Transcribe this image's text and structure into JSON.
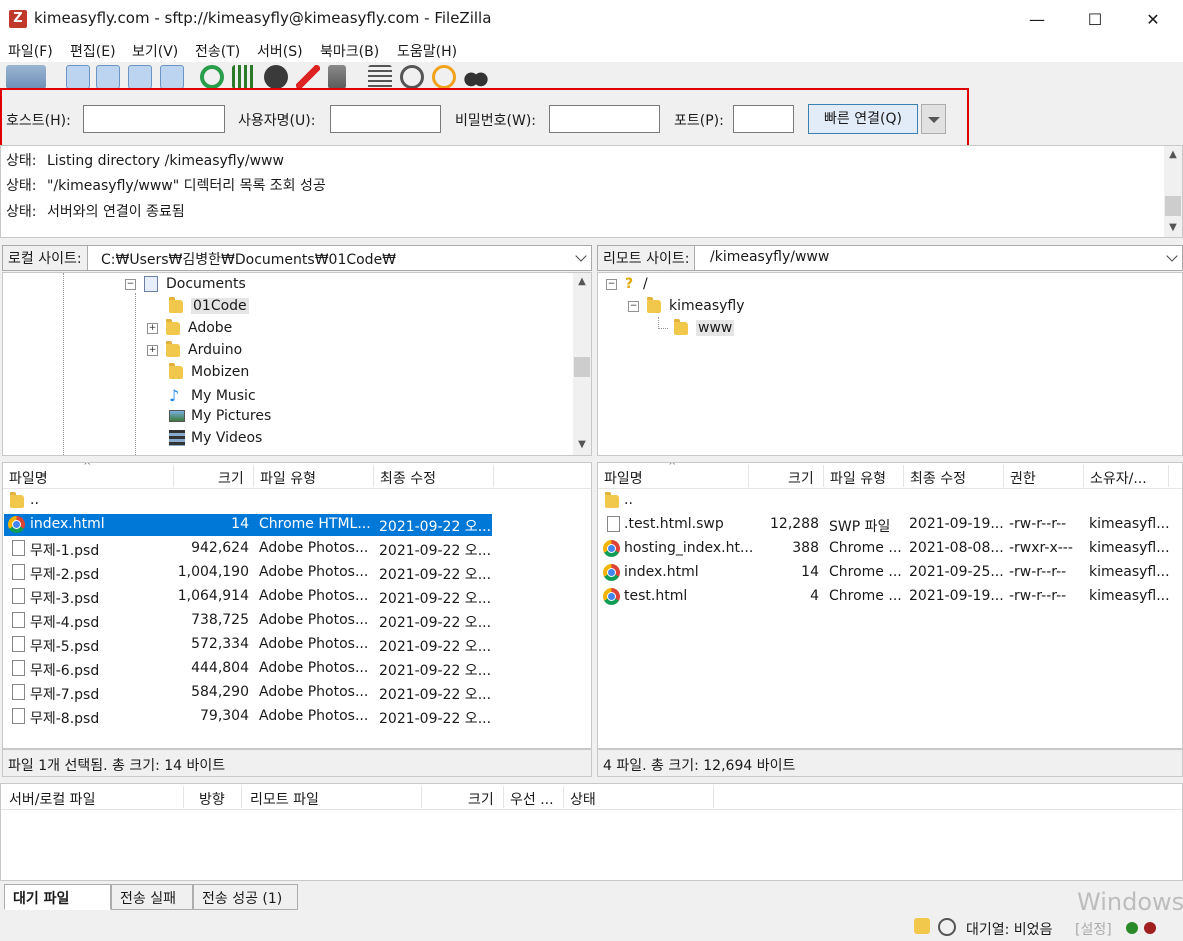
{
  "window": {
    "title": "kimeasyfly.com - sftp://kimeasyfly@kimeasyfly.com - FileZilla",
    "app_icon": "Z",
    "minimize": "—",
    "maximize": "☐",
    "close": "✕"
  },
  "menu": [
    "파일(F)",
    "편집(E)",
    "보기(V)",
    "전송(T)",
    "서버(S)",
    "북마크(B)",
    "도움말(H)"
  ],
  "quickconnect": {
    "host_label": "호스트(H):",
    "host_value": "",
    "user_label": "사용자명(U):",
    "user_value": "",
    "pass_label": "비밀번호(W):",
    "pass_value": "",
    "port_label": "포트(P):",
    "port_value": "",
    "button": "빠른 연결(Q)"
  },
  "messages": [
    {
      "kind": "상태:",
      "text": "Listing directory /kimeasyfly/www"
    },
    {
      "kind": "상태:",
      "text": "\"/kimeasyfly/www\" 디렉터리 목록 조회 성공"
    },
    {
      "kind": "상태:",
      "text": "서버와의 연결이 종료됨"
    }
  ],
  "local": {
    "site_label": "로컬 사이트:",
    "path": "C:₩Users₩김병한₩Documents₩01Code₩",
    "tree": [
      "Documents",
      "01Code",
      "Adobe",
      "Arduino",
      "Mobizen",
      "My Music",
      "My Pictures",
      "My Videos"
    ],
    "columns": [
      "파일명",
      "크기",
      "파일 유형",
      "최종 수정"
    ],
    "files": [
      {
        "name": "..",
        "size": "",
        "type": "",
        "modified": ""
      },
      {
        "name": "index.html",
        "size": "14",
        "type": "Chrome HTML...",
        "modified": "2021-09-22 오..."
      },
      {
        "name": "무제-1.psd",
        "size": "942,624",
        "type": "Adobe Photos...",
        "modified": "2021-09-22 오..."
      },
      {
        "name": "무제-2.psd",
        "size": "1,004,190",
        "type": "Adobe Photos...",
        "modified": "2021-09-22 오..."
      },
      {
        "name": "무제-3.psd",
        "size": "1,064,914",
        "type": "Adobe Photos...",
        "modified": "2021-09-22 오..."
      },
      {
        "name": "무제-4.psd",
        "size": "738,725",
        "type": "Adobe Photos...",
        "modified": "2021-09-22 오..."
      },
      {
        "name": "무제-5.psd",
        "size": "572,334",
        "type": "Adobe Photos...",
        "modified": "2021-09-22 오..."
      },
      {
        "name": "무제-6.psd",
        "size": "444,804",
        "type": "Adobe Photos...",
        "modified": "2021-09-22 오..."
      },
      {
        "name": "무제-7.psd",
        "size": "584,290",
        "type": "Adobe Photos...",
        "modified": "2021-09-22 오..."
      },
      {
        "name": "무제-8.psd",
        "size": "79,304",
        "type": "Adobe Photos...",
        "modified": "2021-09-22 오..."
      }
    ],
    "status": "파일 1개 선택됨. 총 크기: 14 바이트"
  },
  "remote": {
    "site_label": "리모트 사이트:",
    "path": "/kimeasyfly/www",
    "tree": [
      "/",
      "kimeasyfly",
      "www"
    ],
    "columns": [
      "파일명",
      "크기",
      "파일 유형",
      "최종 수정",
      "권한",
      "소유자/..."
    ],
    "files": [
      {
        "name": "..",
        "size": "",
        "type": "",
        "modified": "",
        "perm": "",
        "owner": ""
      },
      {
        "name": ".test.html.swp",
        "size": "12,288",
        "type": "SWP 파일",
        "modified": "2021-09-19...",
        "perm": "-rw-r--r--",
        "owner": "kimeasyfl..."
      },
      {
        "name": "hosting_index.ht...",
        "size": "388",
        "type": "Chrome ...",
        "modified": "2021-08-08...",
        "perm": "-rwxr-x---",
        "owner": "kimeasyfl..."
      },
      {
        "name": "index.html",
        "size": "14",
        "type": "Chrome ...",
        "modified": "2021-09-25...",
        "perm": "-rw-r--r--",
        "owner": "kimeasyfl..."
      },
      {
        "name": "test.html",
        "size": "4",
        "type": "Chrome ...",
        "modified": "2021-09-19...",
        "perm": "-rw-r--r--",
        "owner": "kimeasyfl..."
      }
    ],
    "status": "4 파일. 총 크기: 12,694 바이트"
  },
  "queue": {
    "columns": [
      "서버/로컬 파일",
      "방향",
      "리모트 파일",
      "크기",
      "우선 ...",
      "상태"
    ]
  },
  "tabs": [
    "대기 파일",
    "전송 실패",
    "전송 성공 (1)"
  ],
  "statusbar": {
    "queue": "대기열: 비었음",
    "watermark": "Windows",
    "watermark2": "[설정]"
  },
  "colors": {
    "highlight_border": "#e00000",
    "selection": "#0078d7"
  }
}
